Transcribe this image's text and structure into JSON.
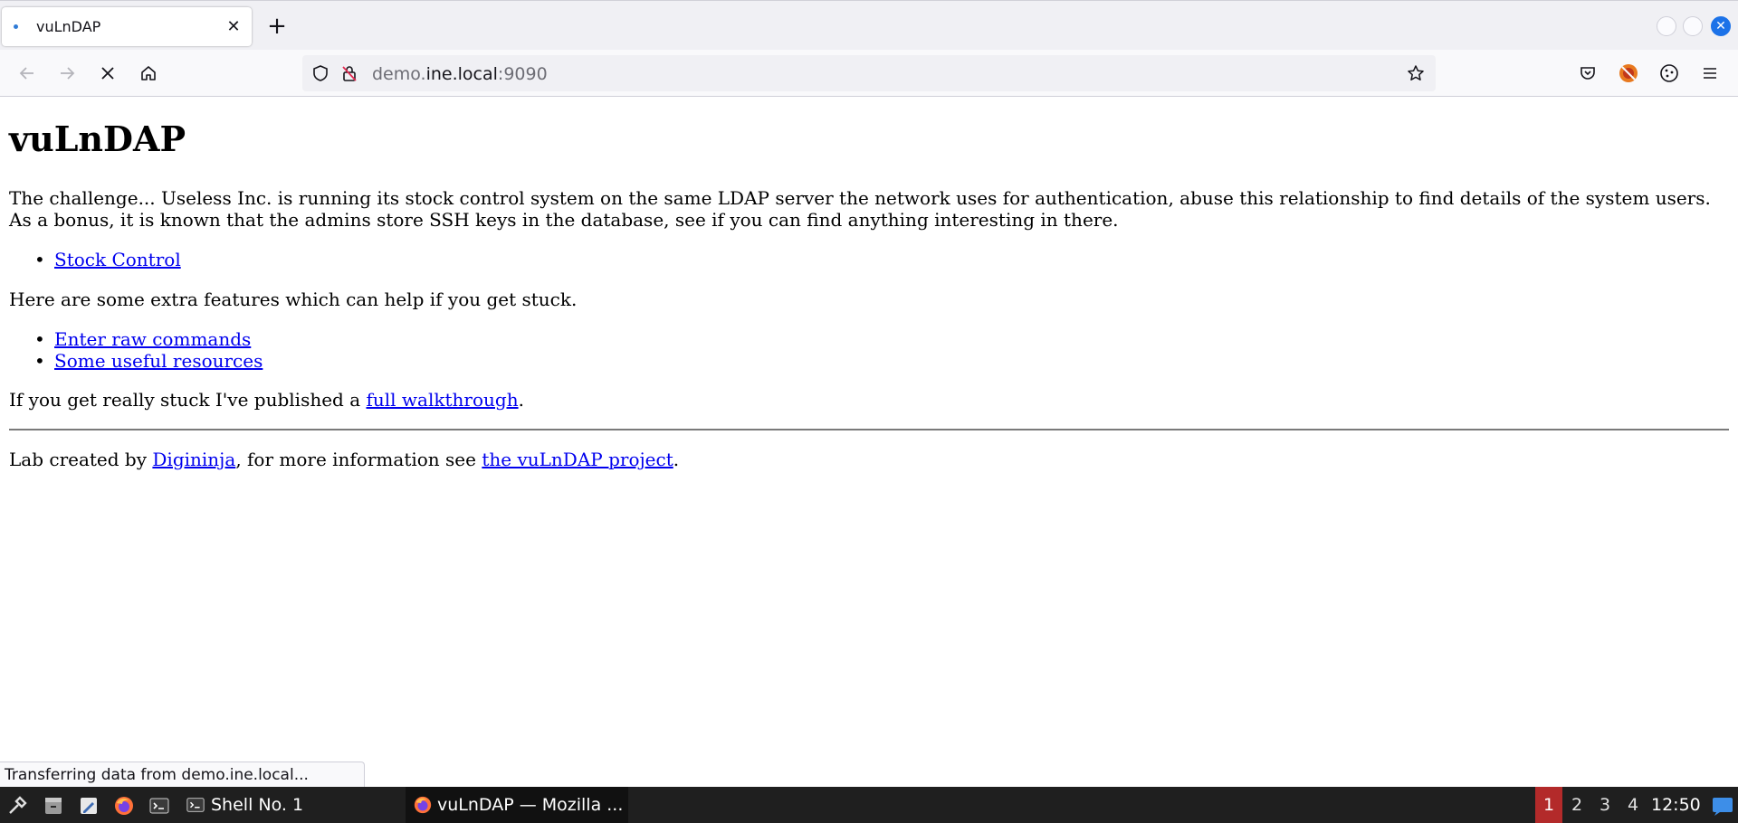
{
  "browser": {
    "tab": {
      "title": "vuLnDAP"
    },
    "url": {
      "host_prefix": "demo.",
      "host": "ine.local",
      "port": ":9090"
    },
    "status": "Transferring data from demo.ine.local..."
  },
  "page": {
    "heading": "vuLnDAP",
    "intro_line1": "The challenge... Useless Inc. is running its stock control system on the same LDAP server the network uses for authentication, abuse this relationship to find details of the system users.",
    "intro_line2": "As a bonus, it is known that the admins store SSH keys in the database, see if you can find anything interesting in there.",
    "main_links": [
      "Stock Control"
    ],
    "extra_intro": "Here are some extra features which can help if you get stuck.",
    "extra_links": [
      "Enter raw commands",
      "Some useful resources"
    ],
    "walkthrough_prefix": "If you get really stuck I've published a ",
    "walkthrough_link": "full walkthrough",
    "walkthrough_suffix": ".",
    "footer_prefix": "Lab created by ",
    "footer_author": "Digininja",
    "footer_middle": ", for more information see ",
    "footer_project": "the vuLnDAP project",
    "footer_suffix": "."
  },
  "taskbar": {
    "tasks": [
      "Shell No. 1",
      "vuLnDAP — Mozilla ..."
    ],
    "workspaces": [
      "1",
      "2",
      "3",
      "4"
    ],
    "active_workspace": "1",
    "clock": "12:50"
  },
  "colors": {
    "link": "#0000ee",
    "taskbar_bg": "#1f1f1f",
    "active_workspace": "#b32a2a",
    "accent": "#1c72e8"
  }
}
